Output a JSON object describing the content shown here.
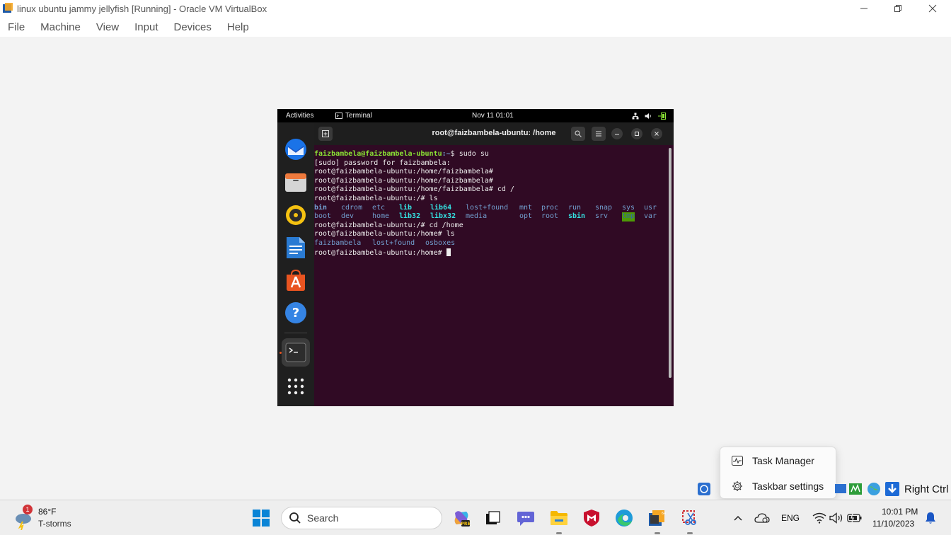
{
  "window": {
    "title": "linux ubuntu jammy jellyfish [Running] - Oracle VM VirtualBox",
    "minimize_icon": "minimize-icon",
    "restore_icon": "restore-icon",
    "close_icon": "close-icon"
  },
  "menubar": {
    "items": [
      "File",
      "Machine",
      "View",
      "Input",
      "Devices",
      "Help"
    ]
  },
  "gnome": {
    "activities": "Activities",
    "app_label": "Terminal",
    "clock": "Nov 11  01:01"
  },
  "terminal": {
    "title": "root@faizbambela-ubuntu: /home",
    "lines": {
      "l1_prompt": "faizbambela@faizbambela-ubuntu",
      "l1_path": ":~",
      "l1_cmd": "$ sudo su",
      "l2": "[sudo] password for faizbambela:",
      "l3": "root@faizbambela-ubuntu:/home/faizbambela#",
      "l4": "root@faizbambela-ubuntu:/home/faizbambela#",
      "l5": "root@faizbambela-ubuntu:/home/faizbambela# cd /",
      "l6": "root@faizbambela-ubuntu:/# ls",
      "l9": "root@faizbambela-ubuntu:/# cd /home",
      "l10": "root@faizbambela-ubuntu:/home# ls",
      "l12": "root@faizbambela-ubuntu:/home# "
    },
    "ls_root_row1": [
      "bin",
      "cdrom",
      "etc",
      "lib",
      "lib64",
      "lost+found",
      "mnt",
      "proc",
      "run",
      "snap",
      "sys",
      "usr"
    ],
    "ls_root_row2": [
      "boot",
      "dev",
      "home",
      "lib32",
      "libx32",
      "media",
      "opt",
      "root",
      "sbin",
      "srv",
      "tmp",
      "var"
    ],
    "ls_home": [
      "faizbambela",
      "lost+found",
      "osboxes"
    ]
  },
  "context_menu": {
    "task_manager": "Task Manager",
    "taskbar_settings": "Taskbar settings"
  },
  "tray_overflow": {
    "host_key": "Right Ctrl"
  },
  "taskbar": {
    "weather_badge": "1",
    "weather_temp": "86°F",
    "weather_cond": "T-storms",
    "search_label": "Search",
    "language": "ENG",
    "time": "10:01 PM",
    "date": "11/10/2023"
  },
  "colors": {
    "terminal_bg": "#300a24",
    "prompt_green": "#8ae234",
    "dir_blue": "#729fcf",
    "accent_orange": "#e95420"
  }
}
